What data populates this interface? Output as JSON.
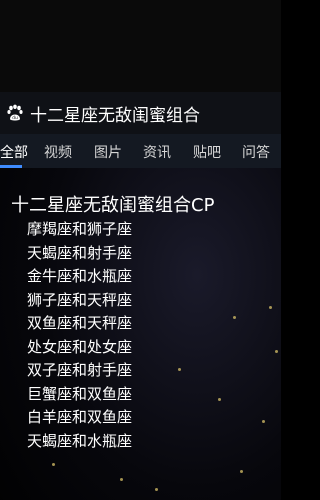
{
  "header": {
    "query": "十二星座无敌闺蜜组合",
    "logo_icon": "baidu-paw-icon"
  },
  "tabs": [
    {
      "label": "全部",
      "active": true
    },
    {
      "label": "视频",
      "active": false
    },
    {
      "label": "图片",
      "active": false
    },
    {
      "label": "资讯",
      "active": false
    },
    {
      "label": "贴吧",
      "active": false
    },
    {
      "label": "问答",
      "active": false
    }
  ],
  "content": {
    "title": "十二星座无敌闺蜜组合CP",
    "pairs": [
      "摩羯座和狮子座",
      "天蝎座和射手座",
      "金牛座和水瓶座",
      "狮子座和天秤座",
      "双鱼座和天秤座",
      "处女座和处女座",
      "双子座和射手座",
      "巨蟹座和双鱼座",
      "白羊座和双鱼座",
      "天蝎座和水瓶座"
    ]
  },
  "colors": {
    "accent": "#3f8cff",
    "background": "#000000",
    "tabbar": "#141922"
  }
}
